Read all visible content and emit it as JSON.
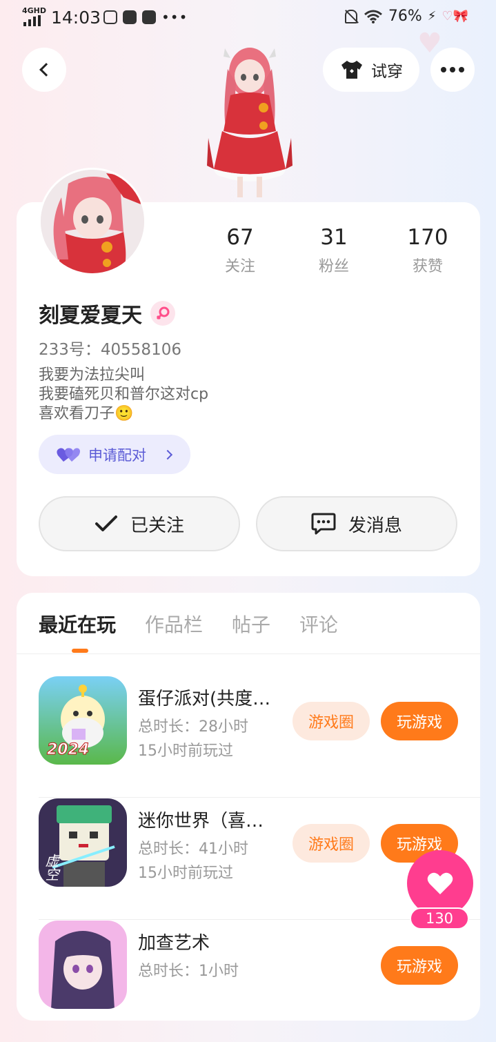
{
  "status_bar": {
    "network": "4GHD",
    "time": "14:03",
    "battery": "76%"
  },
  "header": {
    "try_on_label": "试穿"
  },
  "profile": {
    "stats": [
      {
        "num": "67",
        "label": "关注"
      },
      {
        "num": "31",
        "label": "粉丝"
      },
      {
        "num": "170",
        "label": "获赞"
      }
    ],
    "username": "刻夏爱夏天",
    "uid": "233号：40558106",
    "bio": [
      "我要为法拉尖叫",
      "我要磕死贝和普尔这对cp",
      "喜欢看刀子🙂"
    ],
    "pair_label": "申请配对",
    "follow_label": "已关注",
    "message_label": "发消息"
  },
  "tabs": [
    "最近在玩",
    "作品栏",
    "帖子",
    "评论"
  ],
  "games": [
    {
      "name": "蛋仔派对(共度…",
      "duration": "总时长：28小时",
      "last": "15小时前玩过",
      "circle": "游戏圈",
      "play": "玩游戏",
      "icon_text": "2024"
    },
    {
      "name": "迷你世界（喜…",
      "duration": "总时长：41小时",
      "last": "15小时前玩过",
      "circle": "游戏圈",
      "play": "玩游戏",
      "icon_text": "虚空"
    },
    {
      "name": "加查艺术",
      "duration": "总时长：1小时",
      "last": "",
      "circle": "",
      "play": "玩游戏",
      "icon_text": ""
    }
  ],
  "likes": "130",
  "colors": {
    "accent": "#ff7a1a",
    "pink": "#ff3d8f",
    "purple": "#5b5bd6"
  },
  "icons": [
    "back-icon",
    "tshirt-icon",
    "more-icon",
    "check-icon",
    "chat-icon",
    "heart-icon",
    "female-icon"
  ]
}
